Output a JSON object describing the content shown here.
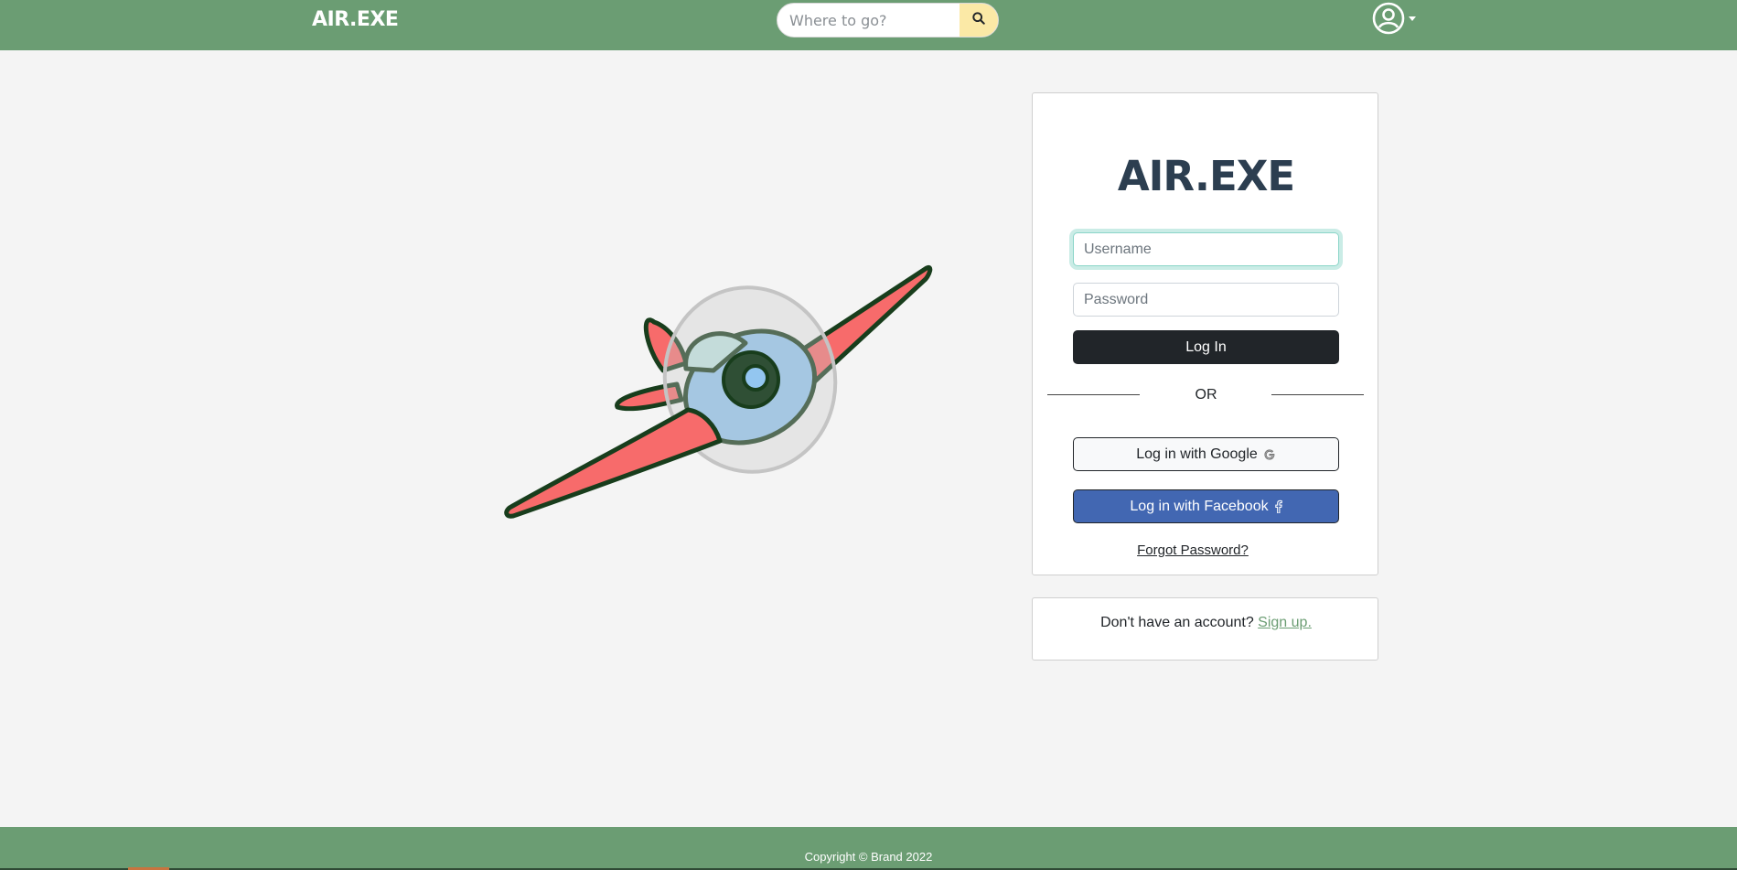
{
  "navbar": {
    "brand": "AIR.EXE",
    "search": {
      "placeholder": "Where to go?",
      "value": ""
    },
    "icons": {
      "search": "search-icon",
      "user": "user-circle-icon",
      "menu": "chevron-down-icon"
    }
  },
  "illustration": {
    "name": "airplane-illustration"
  },
  "login": {
    "title": "AIR.EXE",
    "username_placeholder": "Username",
    "password_placeholder": "Password",
    "login_button": "Log In",
    "or_text": "OR",
    "google_button": "Log in with Google",
    "facebook_button": "Log in with Facebook",
    "forgot_password": "Forgot Password?"
  },
  "signup": {
    "prompt": "Don't have an account?",
    "link": "Sign up."
  },
  "footer": {
    "copyright": "Copyright © Brand 2022"
  },
  "colors": {
    "navbar": "#6b9d73",
    "search_button": "#fbe9a6",
    "title": "#2c3e50",
    "login_button": "#212529",
    "facebook": "#4267b2",
    "focus_ring": "#8ad5c8"
  }
}
